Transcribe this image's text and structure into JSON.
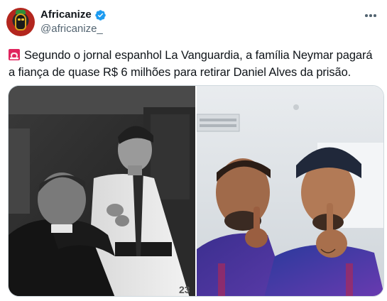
{
  "author": {
    "display_name": "Africanize",
    "handle": "@africanize_",
    "verified": true,
    "verified_color": "#1d9bf0"
  },
  "tweet": {
    "emoji_icon": "rotating-light-icon",
    "text": "Segundo o jornal espanhol La Vanguardia, a família Neymar pagará a fiança de quase R$ 6 milhões para retirar Daniel Alves da prisão."
  },
  "media": {
    "count": 2
  },
  "colors": {
    "text": "#0f1419",
    "secondary": "#536471",
    "border": "#cfd9de",
    "jersey_blue": "#2a3a9c",
    "jersey_purple": "#5b3aa0"
  }
}
